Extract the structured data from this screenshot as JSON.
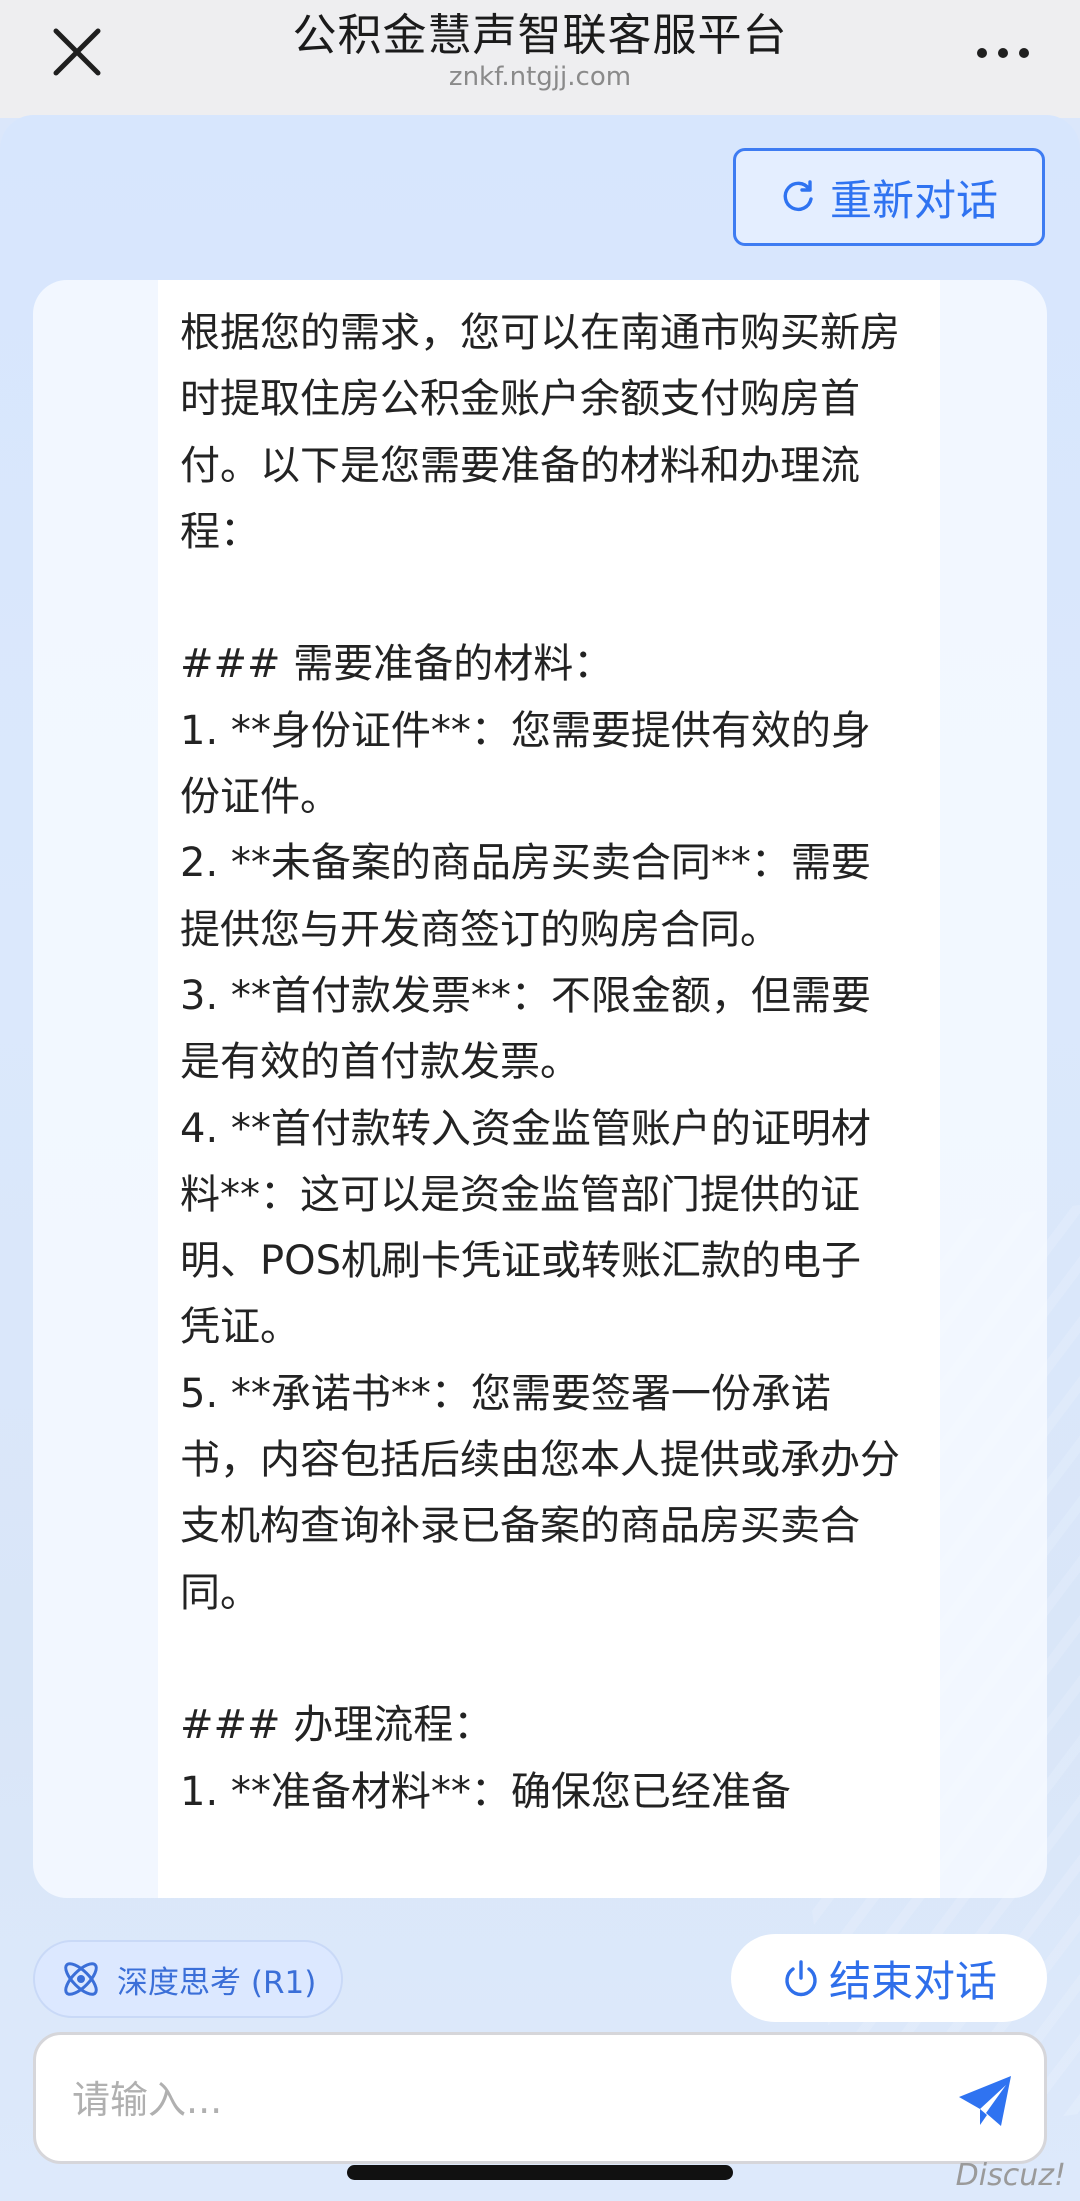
{
  "header": {
    "title": "公积金慧声智联客服平台",
    "subtitle": "znkf.ntgjj.com"
  },
  "toolbar": {
    "restart_label": "重新对话"
  },
  "chat": {
    "message": "根据您的需求，您可以在南通市购买新房时提取住房公积金账户余额支付购房首付。以下是您需要准备的材料和办理流程：\n\n### 需要准备的材料：\n1. **身份证件**：您需要提供有效的身份证件。\n2. **未备案的商品房买卖合同**：需要提供您与开发商签订的购房合同。\n3. **首付款发票**：不限金额，但需要是有效的首付款发票。\n4. **首付款转入资金监管账户的证明材料**：这可以是资金监管部门提供的证明、POS机刷卡凭证或转账汇款的电子凭证。\n5. **承诺书**：您需要签署一份承诺书，内容包括后续由您本人提供或承办分支机构查询补录已备案的商品房买卖合同。\n\n### 办理流程：\n1. **准备材料**：确保您已经准备"
  },
  "controls": {
    "deep_think_label": "深度思考 (R1)",
    "end_label": "结束对话"
  },
  "input": {
    "placeholder": "请输入..."
  },
  "watermark": "Discuz!",
  "colors": {
    "accent": "#2f73f1",
    "background": "#dbe7fb",
    "topbar": "#eeeef0"
  },
  "icons": {
    "close": "close-icon",
    "more": "more-icon",
    "refresh": "refresh-icon",
    "atom": "atom-icon",
    "power": "power-icon",
    "send": "send-icon"
  }
}
